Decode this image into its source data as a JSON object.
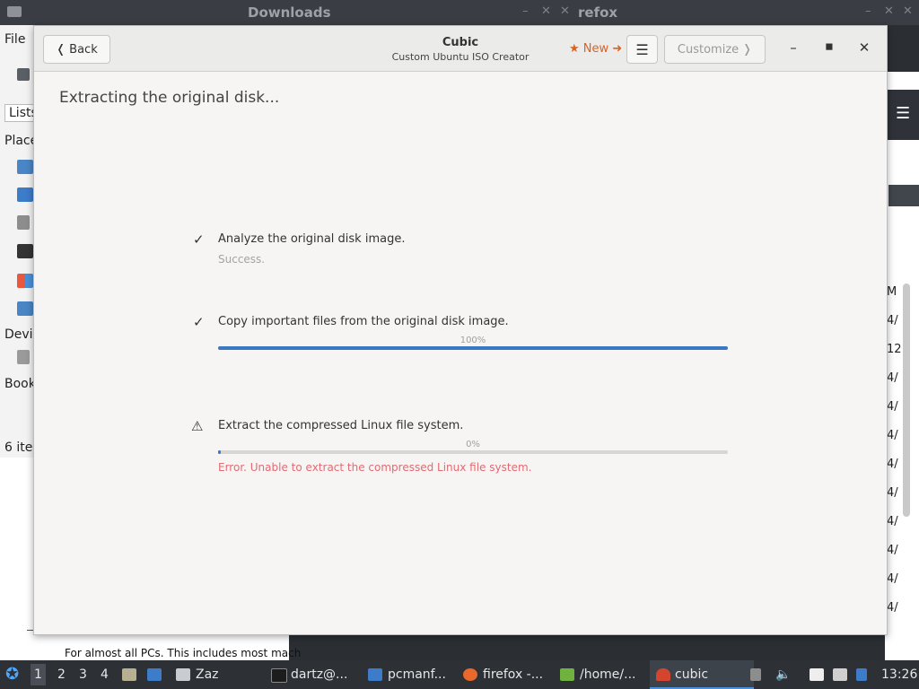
{
  "background": {
    "topbar": {
      "left_title": "Downloads",
      "right_title": "refox"
    },
    "pcmanfm": {
      "menu_file": "File",
      "lists_tab": "Lists",
      "places_label": "Place",
      "devices_label": "Devi",
      "bookmarks_label": "Book",
      "status": "6 ite"
    },
    "web_text": "For almost all PCs. This includes most mach",
    "right_dates": [
      "M",
      "4/",
      "12",
      "4/",
      "4/",
      "4/",
      "4/",
      "4/",
      "4/",
      "4/",
      "4/",
      "4/",
      "4/"
    ]
  },
  "cubic": {
    "back_label": "Back",
    "title": "Cubic",
    "subtitle": "Custom Ubuntu ISO Creator",
    "new_label": "★ New ➜",
    "customize_label": "Customize",
    "heading": "Extracting the original disk...",
    "steps": [
      {
        "icon": "check-icon",
        "label": "Analyze the original disk image.",
        "status": "Success."
      },
      {
        "icon": "check-icon",
        "label": "Copy important files from the original disk image.",
        "progress_text": "100%",
        "progress": 1.0
      },
      {
        "icon": "warning-icon",
        "label": "Extract the compressed Linux file system.",
        "progress_text": "0%",
        "progress": 0.0,
        "error": "Error. Unable to extract the compressed Linux file system."
      }
    ]
  },
  "taskbar": {
    "workspaces": [
      "1",
      "2",
      "3",
      "4"
    ],
    "items": [
      "Zaz",
      "dartz@...",
      "pcmanf...",
      "firefox -...",
      "/home/...",
      "cubic"
    ],
    "clock": "13:26"
  },
  "colors": {
    "accent": "#3b78c2",
    "error": "#e16b73",
    "new_link": "#e0601e",
    "taskbar": "#2d3136"
  }
}
